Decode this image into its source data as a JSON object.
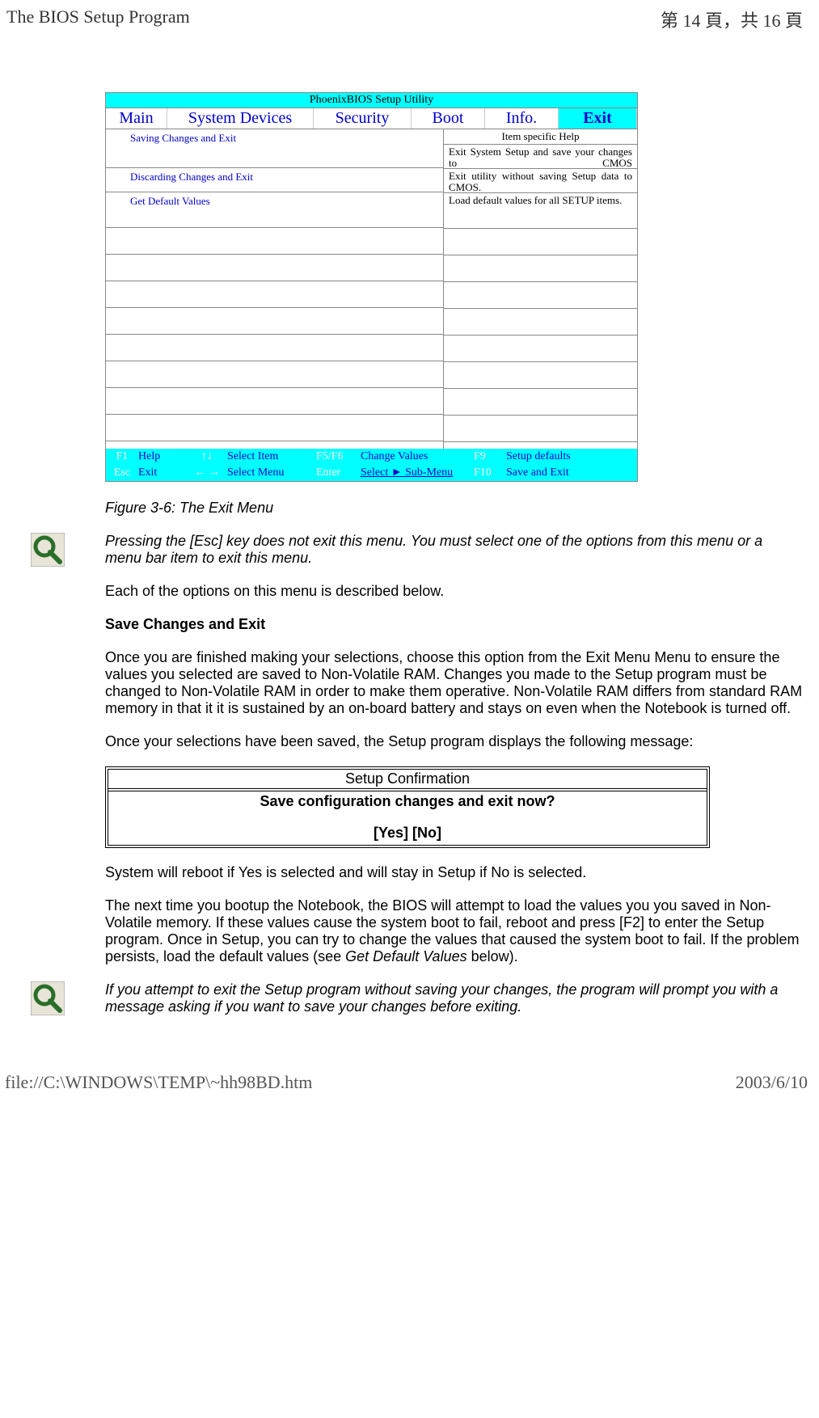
{
  "header": {
    "title_left": "The BIOS Setup Program",
    "title_right": "第 14 頁，共 16 頁"
  },
  "bios": {
    "title": "PhoenixBIOS Setup Utility",
    "tabs": {
      "main": "Main",
      "system_devices": "System Devices",
      "security": "Security",
      "boot": "Boot",
      "info": "Info.",
      "exit": "Exit"
    },
    "help_header": "Item specific Help",
    "items": [
      {
        "label": "Saving Changes and Exit",
        "help": "Exit System Setup and save your changes to CMOS"
      },
      {
        "label": "Discarding Changes and Exit",
        "help": "Exit utility without saving Setup data to CMOS."
      },
      {
        "label": "Get Default Values",
        "help": "Load default values for all SETUP items."
      }
    ],
    "footer": {
      "r1": {
        "k1": "F1",
        "v1": "Help",
        "arrows1": "↑↓",
        "v2": "Select Item",
        "k3": "F5/F6",
        "v3": "Change Values",
        "k4": "F9",
        "v4": "Setup defaults"
      },
      "r2": {
        "k1": "Esc",
        "v1": "Exit",
        "arrows1": "← →",
        "v2": "Select Menu",
        "k3": "Enter",
        "v3": "Select ► Sub-Menu",
        "k4": "F10",
        "v4": "Save and Exit"
      }
    }
  },
  "body": {
    "caption": "Figure 3-6: The Exit Menu",
    "note1": "Pressing the [Esc] key does not exit this menu. You must select one of the options from this menu or a menu bar item to exit this menu.",
    "p1": "Each of the options on this menu is described below.",
    "h1": "Save Changes and Exit",
    "p2": "Once you are finished making your selections, choose this option from the Exit Menu Menu to ensure the values you selected are saved to Non-Volatile RAM. Changes you made to the Setup program must be changed to Non-Volatile RAM in order to make them operative. Non-Volatile RAM differs from standard RAM memory in that it it is sustained by an on-board battery and stays on even when the Notebook is turned off.",
    "p3": "Once your selections have been saved, the Setup program displays the following message:",
    "confirm": {
      "title": "Setup Confirmation",
      "line1": "Save configuration changes and exit now?",
      "line2": "[Yes] [No]"
    },
    "p4": "System will reboot if Yes is selected and will stay in Setup if No is selected.",
    "p5a": "The next time you bootup the Notebook, the BIOS will attempt to load the values you you saved in Non-Volatile memory. If these values cause the system boot to fail, reboot and press [F2] to enter the Setup program. Once in Setup, you can try to change the values that caused the system boot to fail. If the problem persists, load the default values (see ",
    "p5i": "Get Default Values",
    "p5b": " below).",
    "note2": "If you attempt to exit the Setup program without saving your changes, the program will prompt you with a message asking if you want to save your changes before exiting."
  },
  "footer": {
    "left": "file://C:\\WINDOWS\\TEMP\\~hh98BD.htm",
    "right": "2003/6/10"
  }
}
